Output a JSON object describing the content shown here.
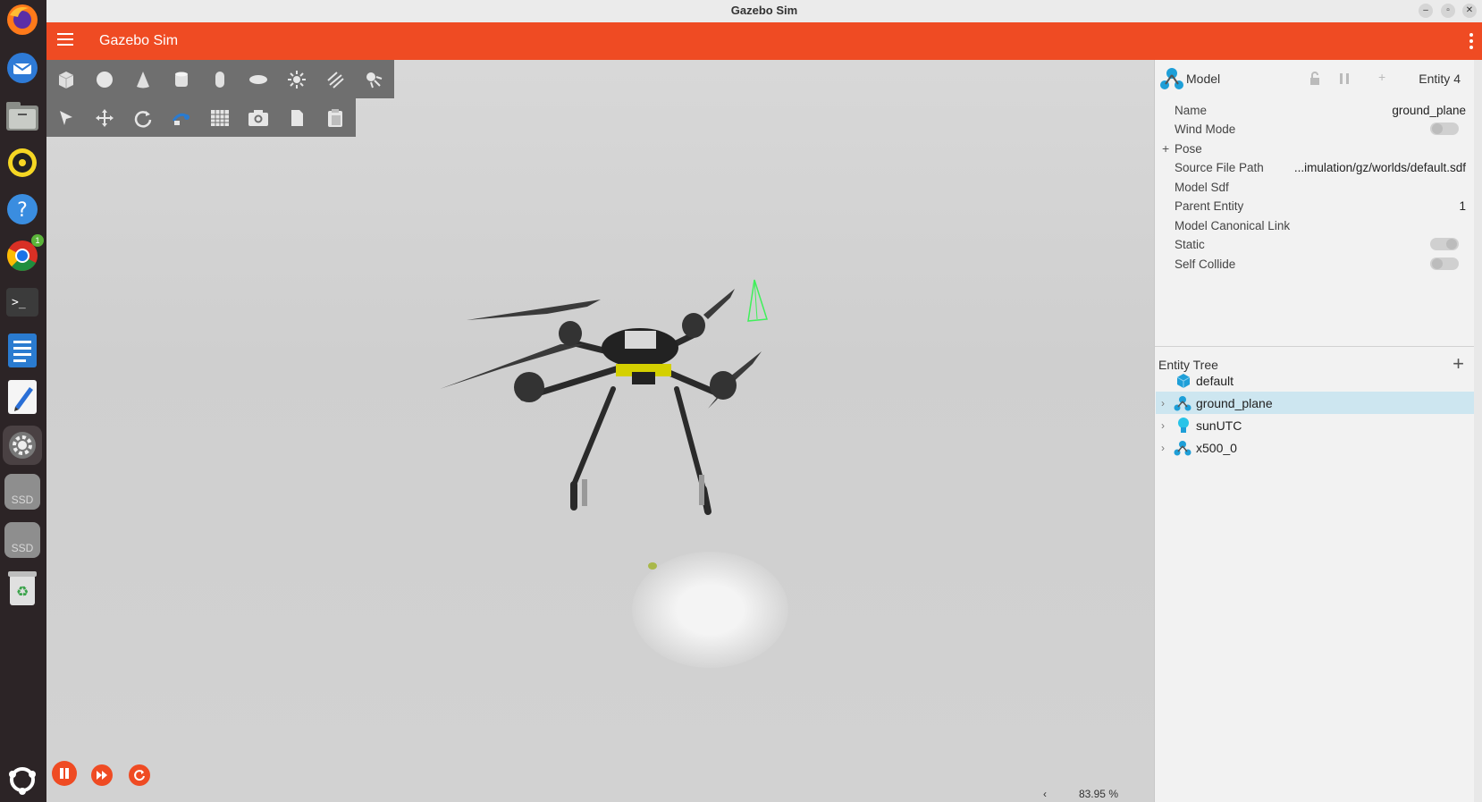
{
  "window": {
    "title": "Gazebo Sim"
  },
  "app": {
    "title": "Gazebo Sim"
  },
  "dock": {
    "items": [
      {
        "name": "firefox-icon"
      },
      {
        "name": "thunderbird-icon"
      },
      {
        "name": "files-icon"
      },
      {
        "name": "rhythmbox-icon"
      },
      {
        "name": "help-icon"
      },
      {
        "name": "chrome-icon",
        "badge": "1"
      },
      {
        "name": "terminal-icon"
      },
      {
        "name": "writer-icon"
      },
      {
        "name": "text-editor-icon"
      },
      {
        "name": "settings-icon"
      },
      {
        "name": "ssd-drive-icon",
        "label": "SSD"
      },
      {
        "name": "ssd-drive-icon",
        "label": "SSD"
      },
      {
        "name": "trash-icon"
      }
    ]
  },
  "toolbar": {
    "shapes": [
      "box-icon",
      "sphere-icon",
      "cone-icon",
      "cylinder-icon",
      "capsule-icon",
      "ellipsoid-icon",
      "point-light-icon",
      "directional-light-icon",
      "spot-light-icon"
    ],
    "tools": [
      "select-icon",
      "translate-icon",
      "rotate-icon",
      "transform-icon",
      "grid-snap-icon",
      "screenshot-icon",
      "copy-icon",
      "paste-icon"
    ]
  },
  "viewport": {
    "zoom": "83.95 %",
    "collapse_arrow": "‹"
  },
  "component_inspector": {
    "type_label": "Model",
    "entity_label": "Entity 4",
    "rows": [
      {
        "key": "Name",
        "value": "ground_plane"
      },
      {
        "key": "Wind Mode",
        "toggle": false
      },
      {
        "key": "Pose",
        "expand": "+"
      },
      {
        "key": "Source File Path",
        "value": "...imulation/gz/worlds/default.sdf"
      },
      {
        "key": "Model Sdf",
        "value": ""
      },
      {
        "key": "Parent Entity",
        "value": "1"
      },
      {
        "key": "Model Canonical Link",
        "value": ""
      },
      {
        "key": "Static",
        "toggle": true
      },
      {
        "key": "Self Collide",
        "toggle": false
      }
    ]
  },
  "entity_tree": {
    "title": "Entity Tree",
    "add_label": "+",
    "items": [
      {
        "label": "default",
        "icon": "world-cube-icon",
        "expandable": false
      },
      {
        "label": "ground_plane",
        "icon": "model-icon",
        "expandable": true,
        "selected": true
      },
      {
        "label": "sunUTC",
        "icon": "light-bulb-icon",
        "expandable": true
      },
      {
        "label": "x500_0",
        "icon": "model-icon",
        "expandable": true
      }
    ]
  },
  "colors": {
    "accent": "#ef4b23",
    "selection": "#cde6f0",
    "toolbar": "#6f6f6f"
  }
}
